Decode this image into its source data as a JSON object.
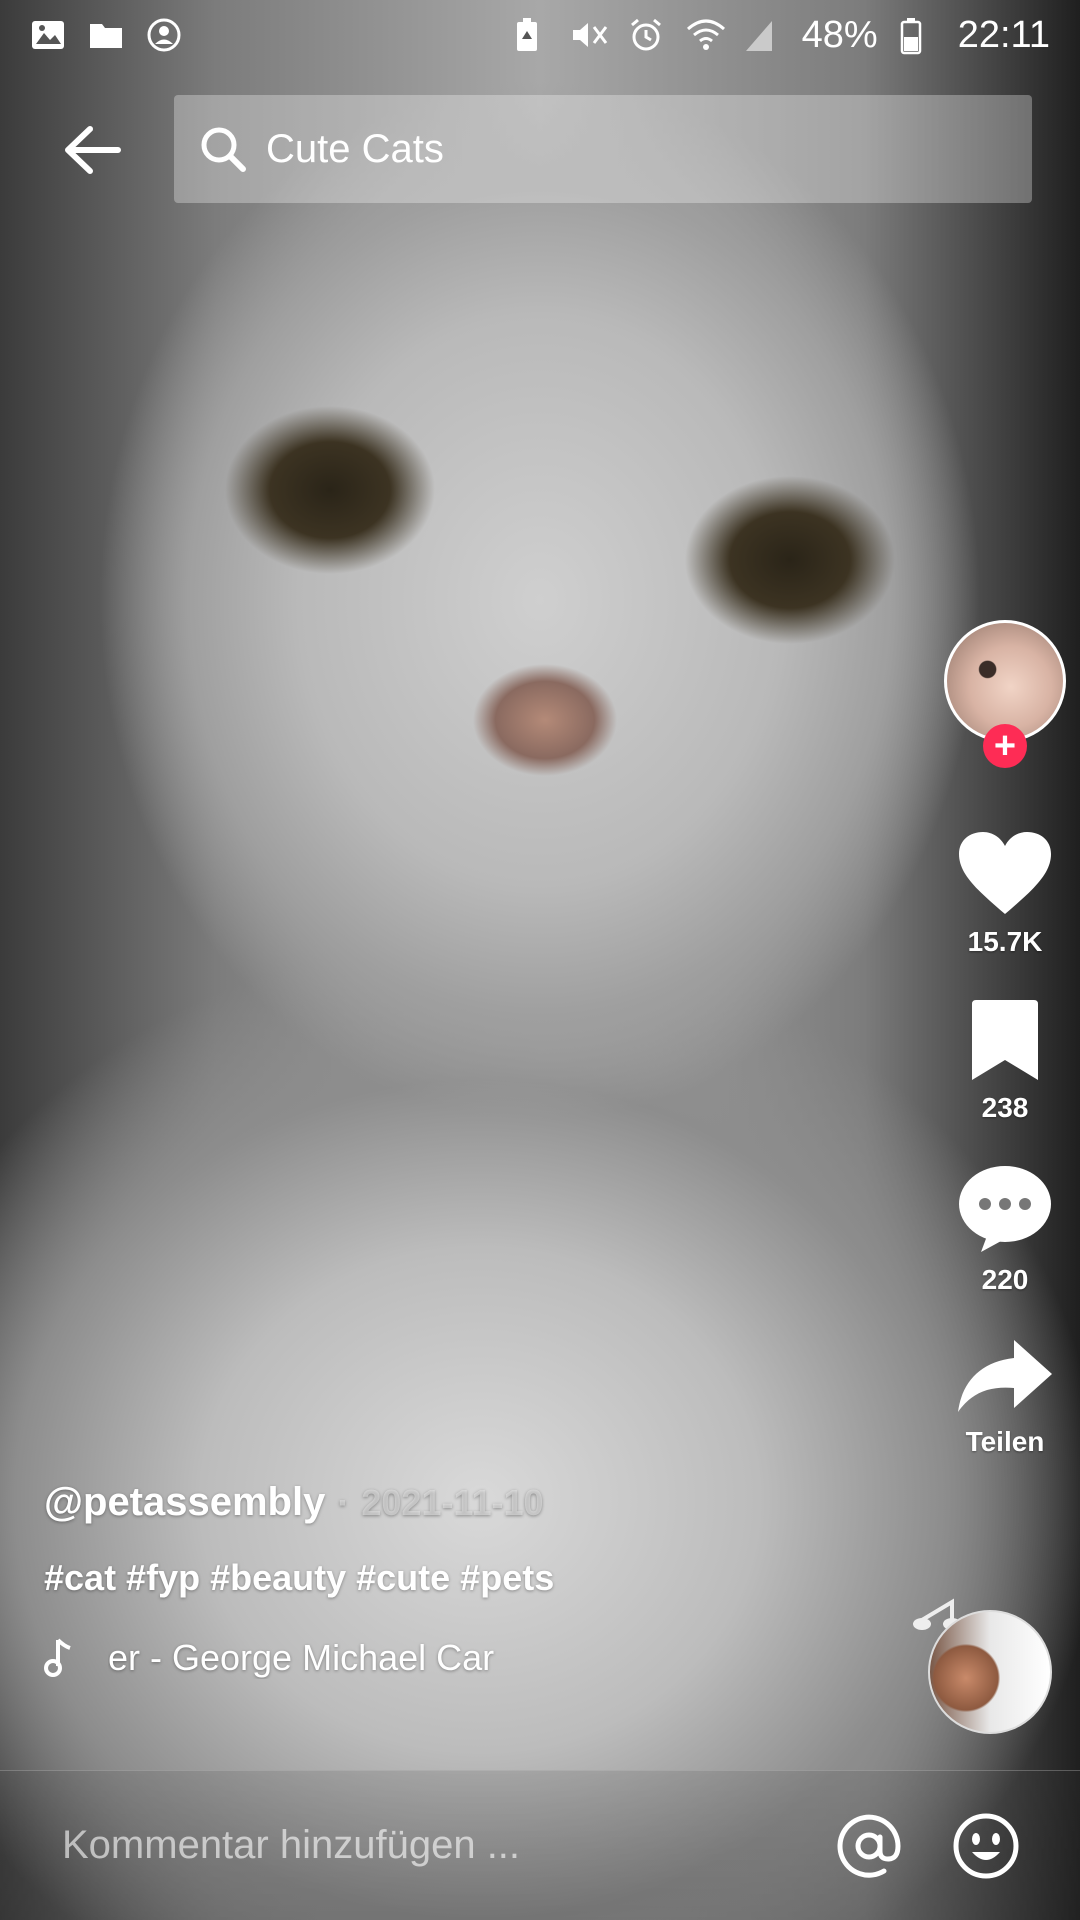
{
  "status_bar": {
    "battery": "48%",
    "time": "22:11"
  },
  "search": {
    "query": "Cute Cats"
  },
  "right_rail": {
    "likes": "15.7K",
    "saves": "238",
    "comments": "220",
    "share_label": "Teilen"
  },
  "caption": {
    "author": "@petassembly",
    "separator": "·",
    "date": "2021-11-10",
    "hashtags": "#cat #fyp #beauty #cute #pets",
    "music": "er - George Michael    Car"
  },
  "comment_bar": {
    "placeholder": "Kommentar hinzufügen ..."
  },
  "colors": {
    "follow_accent": "#fe2c55"
  }
}
